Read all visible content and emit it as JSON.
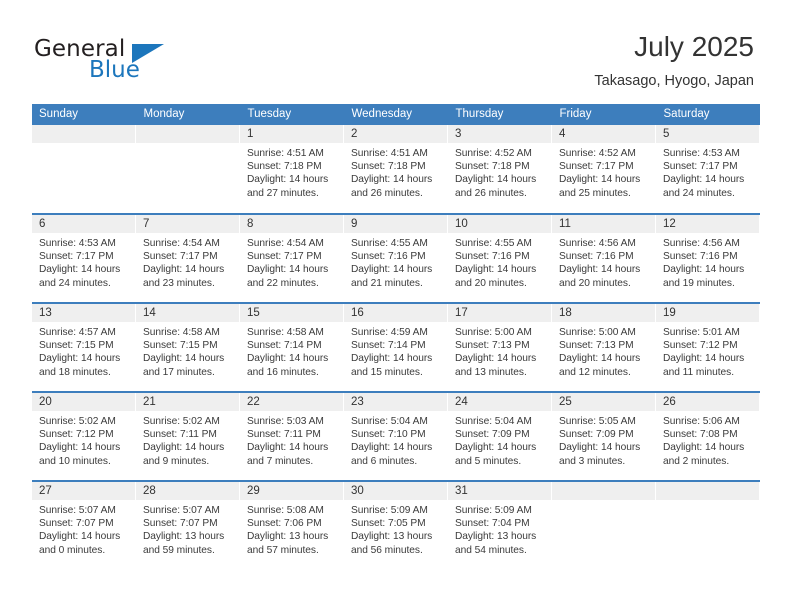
{
  "brand": {
    "word_general": "General",
    "word_blue": "Blue"
  },
  "header": {
    "title": "July 2025",
    "subtitle": "Takasago, Hyogo, Japan"
  },
  "colors": {
    "header_blue": "#3d7ebd",
    "brand_blue": "#1c76bc",
    "daynum_band": "#efefef",
    "text": "#333333"
  },
  "weekdays": [
    "Sunday",
    "Monday",
    "Tuesday",
    "Wednesday",
    "Thursday",
    "Friday",
    "Saturday"
  ],
  "weeks": [
    [
      {
        "day": "",
        "lines": []
      },
      {
        "day": "",
        "lines": []
      },
      {
        "day": "1",
        "lines": [
          "Sunrise: 4:51 AM",
          "Sunset: 7:18 PM",
          "Daylight: 14 hours",
          "and 27 minutes."
        ]
      },
      {
        "day": "2",
        "lines": [
          "Sunrise: 4:51 AM",
          "Sunset: 7:18 PM",
          "Daylight: 14 hours",
          "and 26 minutes."
        ]
      },
      {
        "day": "3",
        "lines": [
          "Sunrise: 4:52 AM",
          "Sunset: 7:18 PM",
          "Daylight: 14 hours",
          "and 26 minutes."
        ]
      },
      {
        "day": "4",
        "lines": [
          "Sunrise: 4:52 AM",
          "Sunset: 7:17 PM",
          "Daylight: 14 hours",
          "and 25 minutes."
        ]
      },
      {
        "day": "5",
        "lines": [
          "Sunrise: 4:53 AM",
          "Sunset: 7:17 PM",
          "Daylight: 14 hours",
          "and 24 minutes."
        ]
      }
    ],
    [
      {
        "day": "6",
        "lines": [
          "Sunrise: 4:53 AM",
          "Sunset: 7:17 PM",
          "Daylight: 14 hours",
          "and 24 minutes."
        ]
      },
      {
        "day": "7",
        "lines": [
          "Sunrise: 4:54 AM",
          "Sunset: 7:17 PM",
          "Daylight: 14 hours",
          "and 23 minutes."
        ]
      },
      {
        "day": "8",
        "lines": [
          "Sunrise: 4:54 AM",
          "Sunset: 7:17 PM",
          "Daylight: 14 hours",
          "and 22 minutes."
        ]
      },
      {
        "day": "9",
        "lines": [
          "Sunrise: 4:55 AM",
          "Sunset: 7:16 PM",
          "Daylight: 14 hours",
          "and 21 minutes."
        ]
      },
      {
        "day": "10",
        "lines": [
          "Sunrise: 4:55 AM",
          "Sunset: 7:16 PM",
          "Daylight: 14 hours",
          "and 20 minutes."
        ]
      },
      {
        "day": "11",
        "lines": [
          "Sunrise: 4:56 AM",
          "Sunset: 7:16 PM",
          "Daylight: 14 hours",
          "and 20 minutes."
        ]
      },
      {
        "day": "12",
        "lines": [
          "Sunrise: 4:56 AM",
          "Sunset: 7:16 PM",
          "Daylight: 14 hours",
          "and 19 minutes."
        ]
      }
    ],
    [
      {
        "day": "13",
        "lines": [
          "Sunrise: 4:57 AM",
          "Sunset: 7:15 PM",
          "Daylight: 14 hours",
          "and 18 minutes."
        ]
      },
      {
        "day": "14",
        "lines": [
          "Sunrise: 4:58 AM",
          "Sunset: 7:15 PM",
          "Daylight: 14 hours",
          "and 17 minutes."
        ]
      },
      {
        "day": "15",
        "lines": [
          "Sunrise: 4:58 AM",
          "Sunset: 7:14 PM",
          "Daylight: 14 hours",
          "and 16 minutes."
        ]
      },
      {
        "day": "16",
        "lines": [
          "Sunrise: 4:59 AM",
          "Sunset: 7:14 PM",
          "Daylight: 14 hours",
          "and 15 minutes."
        ]
      },
      {
        "day": "17",
        "lines": [
          "Sunrise: 5:00 AM",
          "Sunset: 7:13 PM",
          "Daylight: 14 hours",
          "and 13 minutes."
        ]
      },
      {
        "day": "18",
        "lines": [
          "Sunrise: 5:00 AM",
          "Sunset: 7:13 PM",
          "Daylight: 14 hours",
          "and 12 minutes."
        ]
      },
      {
        "day": "19",
        "lines": [
          "Sunrise: 5:01 AM",
          "Sunset: 7:12 PM",
          "Daylight: 14 hours",
          "and 11 minutes."
        ]
      }
    ],
    [
      {
        "day": "20",
        "lines": [
          "Sunrise: 5:02 AM",
          "Sunset: 7:12 PM",
          "Daylight: 14 hours",
          "and 10 minutes."
        ]
      },
      {
        "day": "21",
        "lines": [
          "Sunrise: 5:02 AM",
          "Sunset: 7:11 PM",
          "Daylight: 14 hours",
          "and 9 minutes."
        ]
      },
      {
        "day": "22",
        "lines": [
          "Sunrise: 5:03 AM",
          "Sunset: 7:11 PM",
          "Daylight: 14 hours",
          "and 7 minutes."
        ]
      },
      {
        "day": "23",
        "lines": [
          "Sunrise: 5:04 AM",
          "Sunset: 7:10 PM",
          "Daylight: 14 hours",
          "and 6 minutes."
        ]
      },
      {
        "day": "24",
        "lines": [
          "Sunrise: 5:04 AM",
          "Sunset: 7:09 PM",
          "Daylight: 14 hours",
          "and 5 minutes."
        ]
      },
      {
        "day": "25",
        "lines": [
          "Sunrise: 5:05 AM",
          "Sunset: 7:09 PM",
          "Daylight: 14 hours",
          "and 3 minutes."
        ]
      },
      {
        "day": "26",
        "lines": [
          "Sunrise: 5:06 AM",
          "Sunset: 7:08 PM",
          "Daylight: 14 hours",
          "and 2 minutes."
        ]
      }
    ],
    [
      {
        "day": "27",
        "lines": [
          "Sunrise: 5:07 AM",
          "Sunset: 7:07 PM",
          "Daylight: 14 hours",
          "and 0 minutes."
        ]
      },
      {
        "day": "28",
        "lines": [
          "Sunrise: 5:07 AM",
          "Sunset: 7:07 PM",
          "Daylight: 13 hours",
          "and 59 minutes."
        ]
      },
      {
        "day": "29",
        "lines": [
          "Sunrise: 5:08 AM",
          "Sunset: 7:06 PM",
          "Daylight: 13 hours",
          "and 57 minutes."
        ]
      },
      {
        "day": "30",
        "lines": [
          "Sunrise: 5:09 AM",
          "Sunset: 7:05 PM",
          "Daylight: 13 hours",
          "and 56 minutes."
        ]
      },
      {
        "day": "31",
        "lines": [
          "Sunrise: 5:09 AM",
          "Sunset: 7:04 PM",
          "Daylight: 13 hours",
          "and 54 minutes."
        ]
      },
      {
        "day": "",
        "lines": []
      },
      {
        "day": "",
        "lines": []
      }
    ]
  ]
}
